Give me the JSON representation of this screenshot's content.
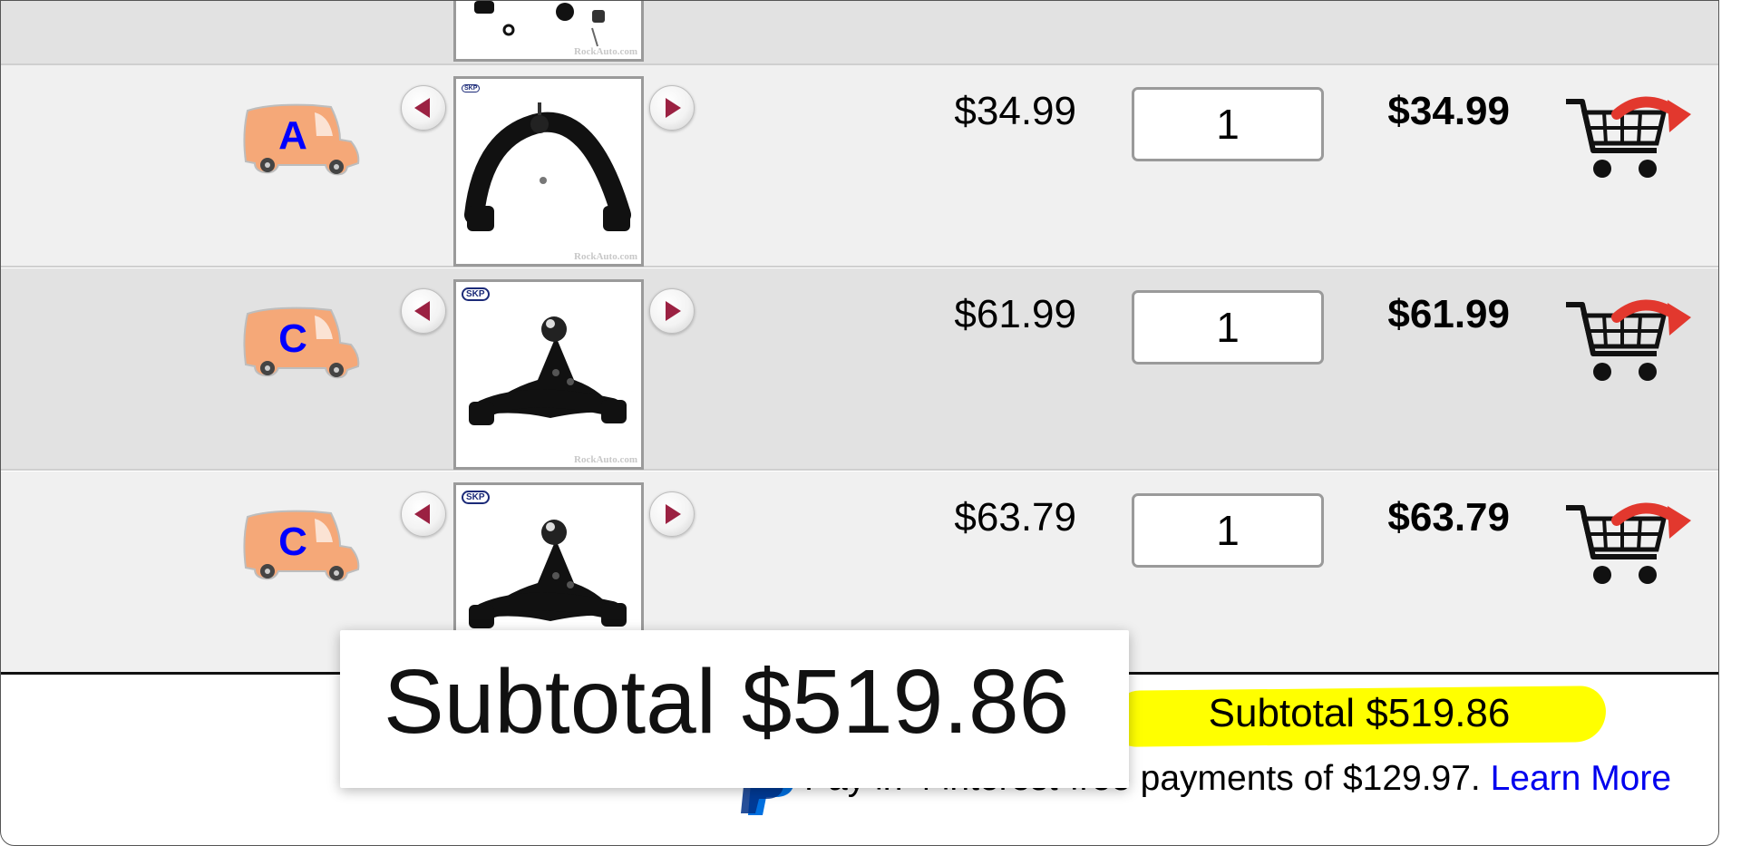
{
  "colors": {
    "row_light": "#f0f0f0",
    "row_dark": "#e2e2e2",
    "highlight": "#ffff00",
    "link": "#0000ee",
    "truck": "#f5a878",
    "truck_letter": "#0000ff",
    "arrow": "#9b2142",
    "cart_arrow": "#e2382e"
  },
  "watermark": "RockAuto.com",
  "products": [
    {
      "availability_code": "A",
      "brand_logo": "SKP",
      "image_icon": "upper-control-arm",
      "price": "$34.99",
      "quantity": "1",
      "total": "$34.99"
    },
    {
      "availability_code": "C",
      "brand_logo": "SKP",
      "image_icon": "lower-control-arm",
      "price": "$61.99",
      "quantity": "1",
      "total": "$61.99"
    },
    {
      "availability_code": "C",
      "brand_logo": "SKP",
      "image_icon": "lower-control-arm",
      "price": "$63.79",
      "quantity": "1",
      "total": "$63.79"
    }
  ],
  "summary": {
    "subtotal": "Subtotal $519.86",
    "pay_later_text": "Pay in 4 interest-free payments of $129.97.",
    "learn_more": "Learn More"
  },
  "magnifier": {
    "text": "Subtotal $519.86"
  }
}
